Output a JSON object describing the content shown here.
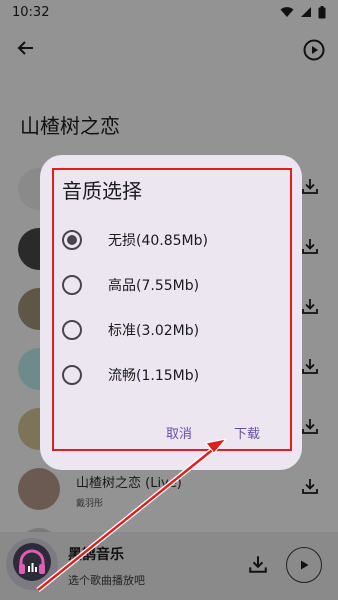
{
  "status_bar": {
    "time": "10:32"
  },
  "page": {
    "title": "山楂树之恋"
  },
  "songs": [
    {
      "title": "",
      "artist": ""
    },
    {
      "title": "",
      "artist": ""
    },
    {
      "title": "",
      "artist": ""
    },
    {
      "title": "",
      "artist": ""
    },
    {
      "title": "",
      "artist": ""
    },
    {
      "title": "山楂树之恋 (Live)",
      "artist": "戴羽彤"
    },
    {
      "title": "",
      "artist": ""
    }
  ],
  "dialog": {
    "title": "音质选择",
    "options": [
      {
        "label": "无损(40.85Mb)",
        "selected": true
      },
      {
        "label": "高品(7.55Mb)",
        "selected": false
      },
      {
        "label": "标准(3.02Mb)",
        "selected": false
      },
      {
        "label": "流畅(1.15Mb)",
        "selected": false
      }
    ],
    "cancel_label": "取消",
    "download_label": "下载"
  },
  "player": {
    "title": "黑鹊音乐",
    "subtitle": "选个歌曲播放吧"
  },
  "colors": {
    "accent": "#6750a4",
    "annotation_red": "#e02020",
    "scrim": "#939393",
    "dialog_bg": "#ece6f0"
  },
  "icons": {
    "back": "arrow-left-icon",
    "play_circle": "play-circle-icon",
    "download": "download-icon",
    "play": "play-icon",
    "wifi": "wifi-icon",
    "signal": "signal-icon",
    "battery": "battery-icon",
    "headphones": "headphones-icon"
  }
}
